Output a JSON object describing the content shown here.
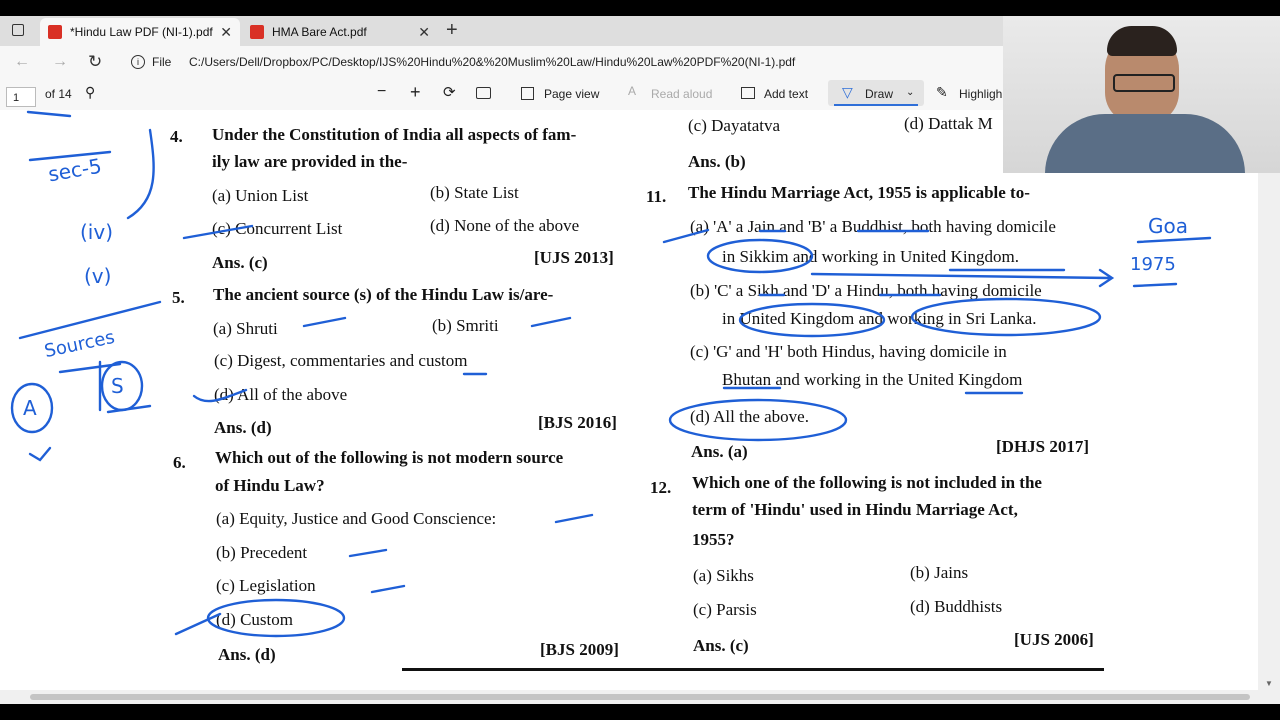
{
  "tabs": [
    {
      "title": "*Hindu Law PDF (NI-1).pdf",
      "close": "✕"
    },
    {
      "title": "HMA Bare Act.pdf",
      "close": "✕"
    }
  ],
  "new_tab": "+",
  "address": {
    "file_label": "File",
    "url": "C:/Users/Dell/Dropbox/PC/Desktop/IJS%20Hindu%20&%20Muslim%20Law/Hindu%20Law%20PDF%20(NI-1).pdf"
  },
  "toolbar": {
    "page_number": "1",
    "page_count": "of 14",
    "zoom_out": "−",
    "zoom_in": "+",
    "page_view": "Page view",
    "read_aloud": "Read aloud",
    "add_text": "Add text",
    "draw": "Draw",
    "highlight": "Highligh"
  },
  "doc": {
    "top_right_c": "(c)  Dayatatva",
    "top_right_d": "(d)  Dattak M",
    "top_ans": "Ans. (b)",
    "q4": {
      "num": "4.",
      "l1": "Under the Constitution of India all aspects of fam-",
      "l2": "ily law are provided in the-",
      "a": "(a)  Union List",
      "b": "(b)  State List",
      "c": "(c)  Concurrent List",
      "d": "(d)  None of the above",
      "ans": "Ans. (c)",
      "src": "[UJS 2013]"
    },
    "q5": {
      "num": "5.",
      "l1": "The ancient source (s) of the Hindu Law is/are-",
      "a": "(a)  Shruti",
      "b": "(b)  Smriti",
      "c": "(c)  Digest, commentaries and custom",
      "d": "(d)  All of the above",
      "ans": "Ans. (d)",
      "src": "[BJS 2016]"
    },
    "q6": {
      "num": "6.",
      "l1": "Which out of the following is not modern source",
      "l2": "of Hindu Law?",
      "a": "(a)  Equity, Justice and Good Conscience:",
      "b": "(b)  Precedent",
      "c": "(c)  Legislation",
      "d": "(d)  Custom",
      "ans": "Ans. (d)",
      "src": "[BJS 2009]"
    },
    "q11": {
      "num": "11.",
      "l1": "The Hindu Marriage Act, 1955 is applicable to-",
      "a1": "(a)  'A' a Jain and 'B' a Buddhist, both having domicile",
      "a2": "in Sikkim and working in United Kingdom.",
      "b1": "(b)  'C' a Sikh and 'D' a Hindu, both having domicile",
      "b2": "in United Kingdom and working in Sri Lanka.",
      "c1": "(c)  'G' and 'H' both Hindus, having domicile in",
      "c2": "Bhutan and working in the United Kingdom",
      "d": "(d)  All the above.",
      "ans": "Ans. (a)",
      "src": "[DHJS 2017]"
    },
    "q12": {
      "num": "12.",
      "l1": "Which one of the following is not included in the",
      "l2": "term of 'Hindu' used in Hindu Marriage Act,",
      "l3": "1955?",
      "a": "(a)  Sikhs",
      "b": "(b)  Jains",
      "c": "(c)  Parsis",
      "d": "(d)  Buddhists",
      "ans": "Ans. (c)",
      "src": "[UJS 2006]"
    }
  },
  "annotations": {
    "sec": "sec-5",
    "iv": "(iv)",
    "v": "(v)",
    "sources": "Sources",
    "a_letter": "A",
    "s_letter": "S",
    "goa": "Goa",
    "year": "1975"
  },
  "colors": {
    "ink": "#1f5fd6",
    "tab_bg": "#dedede",
    "toolbar_bg": "#f7f7f7",
    "accent": "#2f6fd8"
  }
}
